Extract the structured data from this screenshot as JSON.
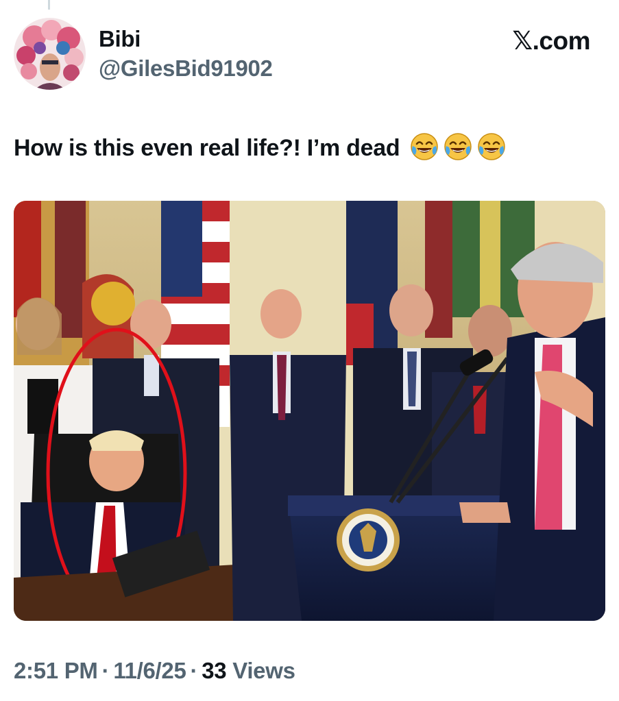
{
  "author": {
    "display_name": "Bibi",
    "handle": "@GilesBid91902",
    "avatar_icon": "floral-portrait-avatar"
  },
  "brand": {
    "icon": "x-logo-icon",
    "glyph": "𝕏",
    "suffix": ".com"
  },
  "tweet": {
    "text": "How is this even real life?! I’m dead",
    "emojis": [
      "face-with-tears-of-joy",
      "face-with-tears-of-joy",
      "face-with-tears-of-joy"
    ]
  },
  "media": {
    "icon": "photo-press-conference-image",
    "highlight_color": "#e0101a"
  },
  "meta": {
    "time": "2:51 PM",
    "separator": "·",
    "date": "11/6/25",
    "views_count": "33",
    "views_label": "Views"
  },
  "colors": {
    "text": "#0f1419",
    "secondary": "#536471",
    "background": "#ffffff"
  }
}
